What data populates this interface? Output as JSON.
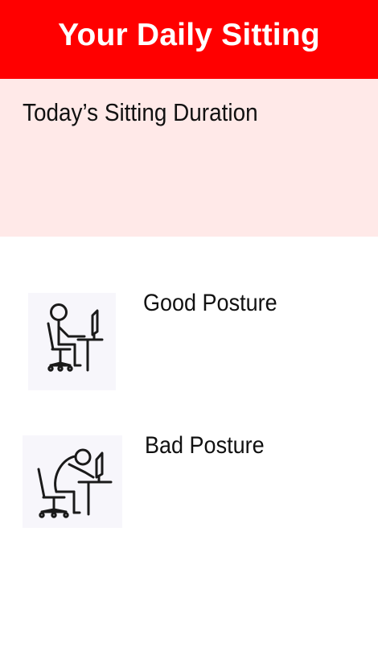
{
  "header": {
    "title": "Your Daily Sitting",
    "background": "#ff0000",
    "text_color": "#ffffff"
  },
  "duration_panel": {
    "title": "Today’s Sitting Duration",
    "background": "#ffe9e8"
  },
  "postures": [
    {
      "label": "Good Posture",
      "icon": "good-posture-icon"
    },
    {
      "label": "Bad Posture",
      "icon": "bad-posture-icon"
    }
  ]
}
